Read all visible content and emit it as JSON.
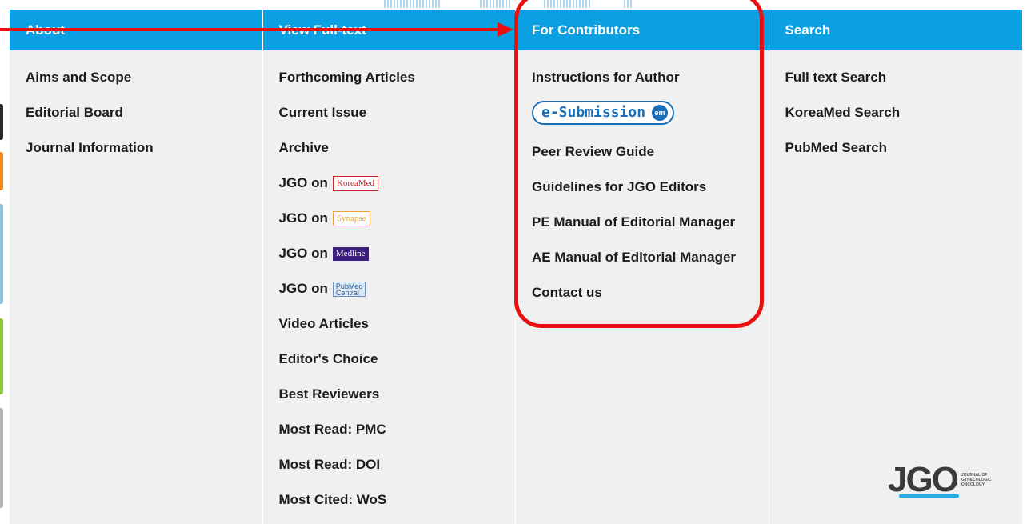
{
  "columns": [
    {
      "title": "About",
      "items": [
        "Aims and Scope",
        "Editorial Board",
        "Journal Information"
      ]
    },
    {
      "title": "View Full-text",
      "items": [
        "Forthcoming Articles",
        "Current Issue",
        "Archive"
      ],
      "jgo_links": [
        {
          "prefix": "JGO on",
          "badge": "KoreaMed"
        },
        {
          "prefix": "JGO on",
          "badge": "Synapse"
        },
        {
          "prefix": "JGO on",
          "badge": "Medline"
        },
        {
          "prefix": "JGO on",
          "badge": "PubMed Central"
        }
      ],
      "items_after": [
        "Video Articles",
        "Editor's Choice",
        "Best Reviewers",
        "Most Read: PMC",
        "Most Read: DOI",
        "Most Cited: WoS"
      ]
    },
    {
      "title": "For Contributors",
      "items": [
        "Instructions for Author"
      ],
      "esubmission": {
        "label": "e-Submission",
        "icon_text": "em"
      },
      "items_after": [
        "Peer Review Guide",
        "Guidelines for JGO Editors",
        "PE Manual of Editorial Manager",
        "AE Manual of Editorial Manager",
        "Contact us"
      ]
    },
    {
      "title": "Search",
      "items": [
        "Full text Search",
        "KoreaMed Search",
        "PubMed Search"
      ]
    }
  ],
  "logo": {
    "mark": "JGO",
    "text": "JOURNAL OF GYNECOLOGIC ONCOLOGY"
  },
  "colors": {
    "header": "#0aa0e2",
    "annotation": "#e81010",
    "menu_bg": "#f0f0f0"
  }
}
